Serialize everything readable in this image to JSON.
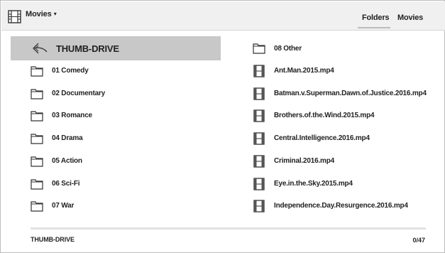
{
  "header": {
    "title": "Movies",
    "caret": "▾",
    "tabs": [
      {
        "label": "Folders",
        "selected": true
      },
      {
        "label": "Movies",
        "selected": false
      }
    ]
  },
  "back": {
    "label": "THUMB-DRIVE",
    "icon": "reply-arrow-icon"
  },
  "left_folders": [
    {
      "label": "01 Comedy",
      "icon": "folder-icon"
    },
    {
      "label": "02 Documentary",
      "icon": "folder-icon"
    },
    {
      "label": "03 Romance",
      "icon": "folder-icon"
    },
    {
      "label": "04 Drama",
      "icon": "folder-icon"
    },
    {
      "label": "05 Action",
      "icon": "folder-icon"
    },
    {
      "label": "06 Sci-Fi",
      "icon": "folder-icon"
    },
    {
      "label": "07 War",
      "icon": "folder-icon"
    }
  ],
  "right_items": [
    {
      "label": "08 Other",
      "icon": "folder-icon"
    },
    {
      "label": "Ant.Man.2015.mp4",
      "icon": "film-icon"
    },
    {
      "label": "Batman.v.Superman.Dawn.of.Justice.2016.mp4",
      "icon": "film-icon"
    },
    {
      "label": "Brothers.of.the.Wind.2015.mp4",
      "icon": "film-icon"
    },
    {
      "label": "Central.Intelligence.2016.mp4",
      "icon": "film-icon"
    },
    {
      "label": "Criminal.2016.mp4",
      "icon": "film-icon"
    },
    {
      "label": "Eye.in.the.Sky.2015.mp4",
      "icon": "film-icon"
    },
    {
      "label": "Independence.Day.Resurgence.2016.mp4",
      "icon": "film-icon"
    }
  ],
  "footer": {
    "path": "THUMB-DRIVE",
    "counter": "0/47"
  },
  "colors": {
    "header_bg": "#f0f0f0",
    "selected_row_bg": "#c8c8c8",
    "tab_underline": "#bcbcbc"
  }
}
